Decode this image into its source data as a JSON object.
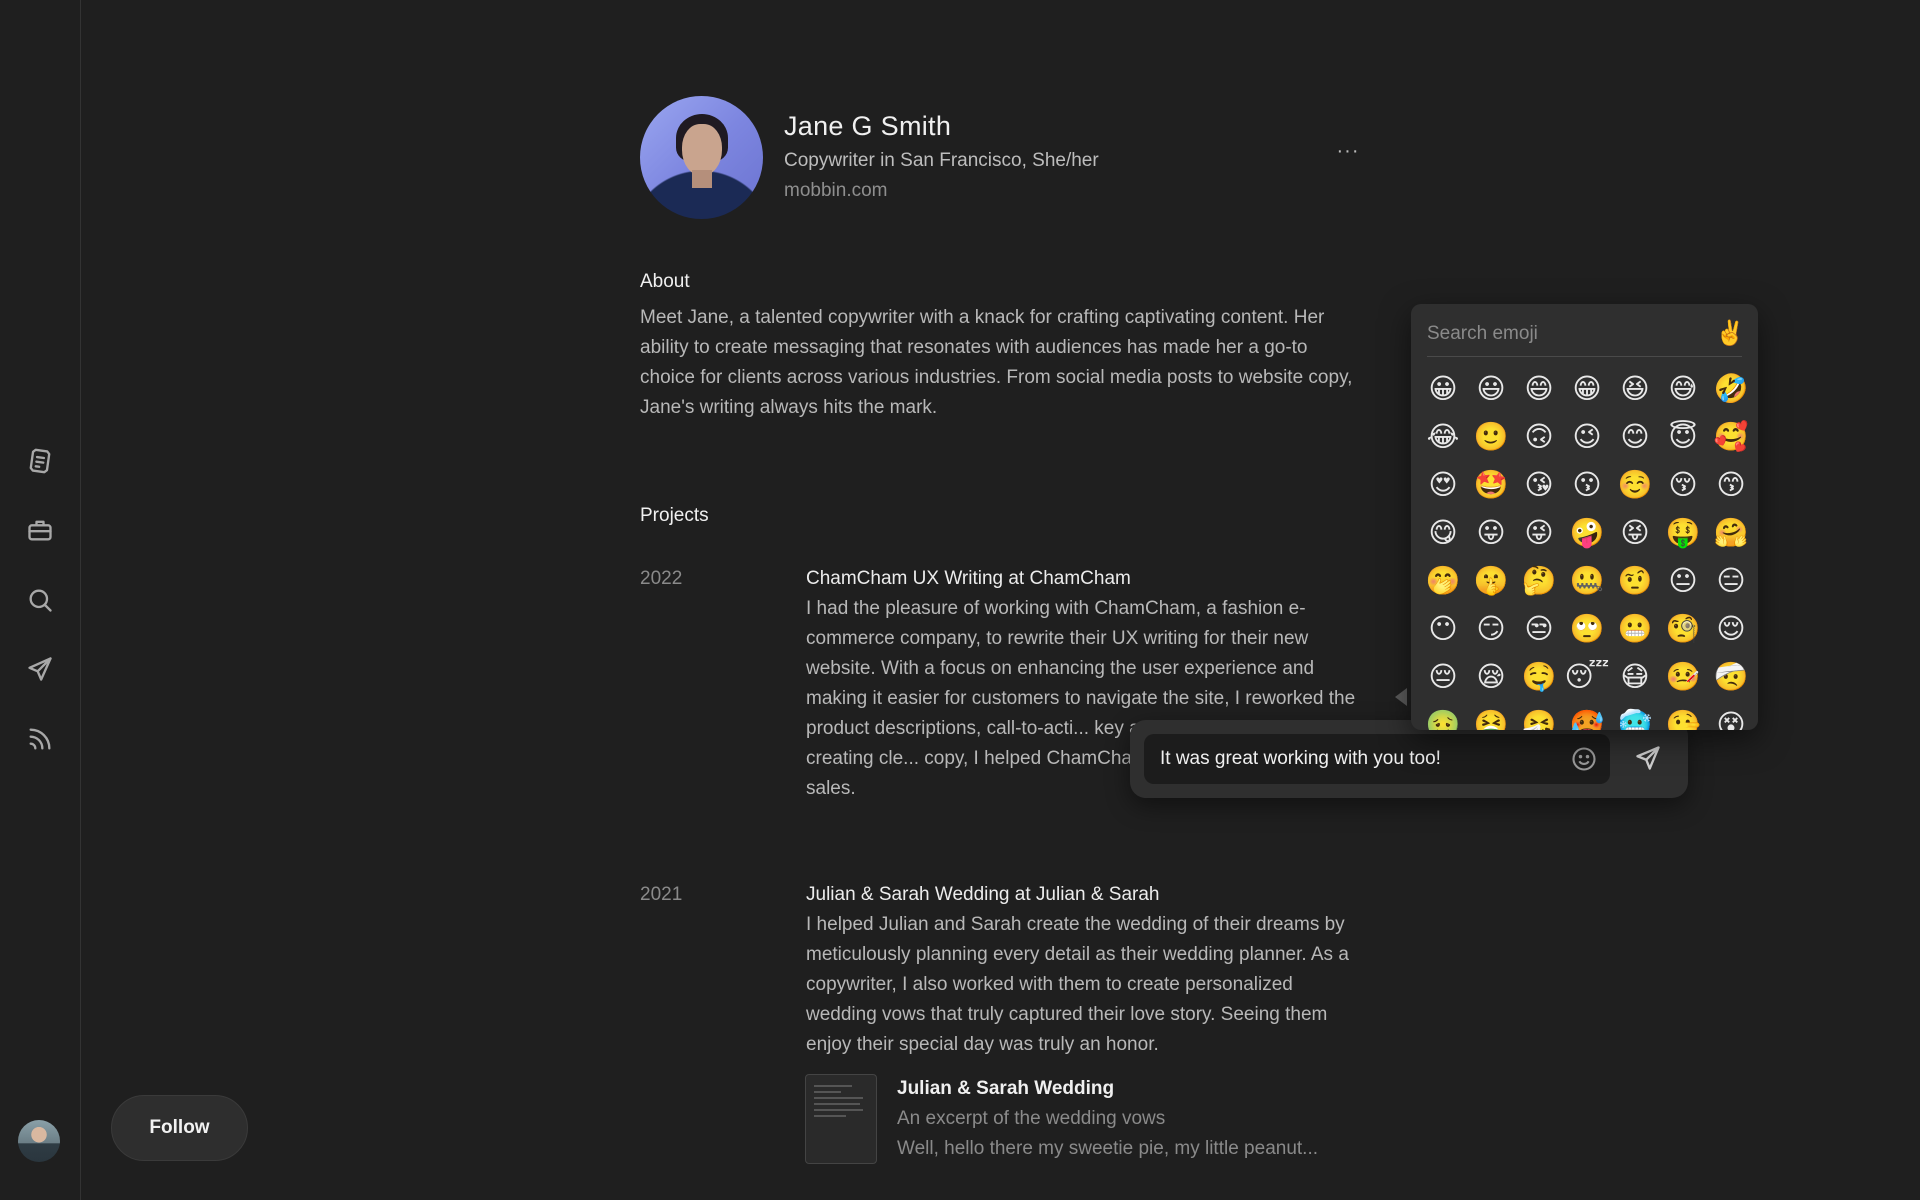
{
  "sidebar": {
    "icons": [
      "notes-icon",
      "briefcase-icon",
      "search-icon",
      "send-icon",
      "rss-icon"
    ]
  },
  "follow_label": "Follow",
  "profile": {
    "name": "Jane G Smith",
    "role": "Copywriter in San Francisco, She/her",
    "website": "mobbin.com",
    "more": "···"
  },
  "about": {
    "title": "About",
    "text": "Meet Jane, a talented copywriter with a knack for crafting captivating content. Her ability to create messaging that resonates with audiences has made her a go-to choice for clients across various industries. From social media posts to website copy, Jane's writing always hits the mark."
  },
  "projects": {
    "title": "Projects",
    "items": [
      {
        "year": "2022",
        "title": "ChamCham UX Writing at ChamCham",
        "desc": "I had the pleasure of working with ChamCham, a fashion e-commerce company, to rewrite their UX writing for their new website. With a focus on enhancing the user experience and making it easier for customers to navigate the site, I reworked the product descriptions, call-to-acti... key areas of the site. By creating cle... copy, I helped ChamCham improve t... and increase sales."
      },
      {
        "year": "2021",
        "title": "Julian & Sarah Wedding at Julian & Sarah",
        "desc": "I helped Julian and Sarah create the wedding of their dreams by meticulously planning every detail as their wedding planner. As a copywriter, I also worked with them to create personalized wedding vows that truly captured their love story. Seeing them enjoy their special day was truly an honor."
      }
    ],
    "attachment": {
      "title": "Julian & Sarah Wedding",
      "subtitle": "An excerpt of the wedding vows",
      "excerpt": "Well, hello there my sweetie pie, my little peanut..."
    }
  },
  "reply": {
    "value": "It was great working with you too!"
  },
  "emoji_picker": {
    "search_placeholder": "Search emoji",
    "skin_tone": "✌️",
    "emojis": [
      "😀",
      "😃",
      "😄",
      "😁",
      "😆",
      "😅",
      "🤣",
      "😂",
      "🙂",
      "🙃",
      "😉",
      "😊",
      "😇",
      "🥰",
      "😍",
      "🤩",
      "😘",
      "😗",
      "☺️",
      "😚",
      "😙",
      "😋",
      "😛",
      "😜",
      "🤪",
      "😝",
      "🤑",
      "🤗",
      "🤭",
      "🤫",
      "🤔",
      "🤐",
      "🤨",
      "😐",
      "😑",
      "😶",
      "😏",
      "😒",
      "🙄",
      "😬",
      "🧐",
      "😌",
      "😔",
      "😪",
      "🤤",
      "😴",
      "😷",
      "🤒",
      "🤕",
      "🤢",
      "🤮",
      "🤧",
      "🥵",
      "🥶",
      "🤥",
      "😵"
    ]
  }
}
